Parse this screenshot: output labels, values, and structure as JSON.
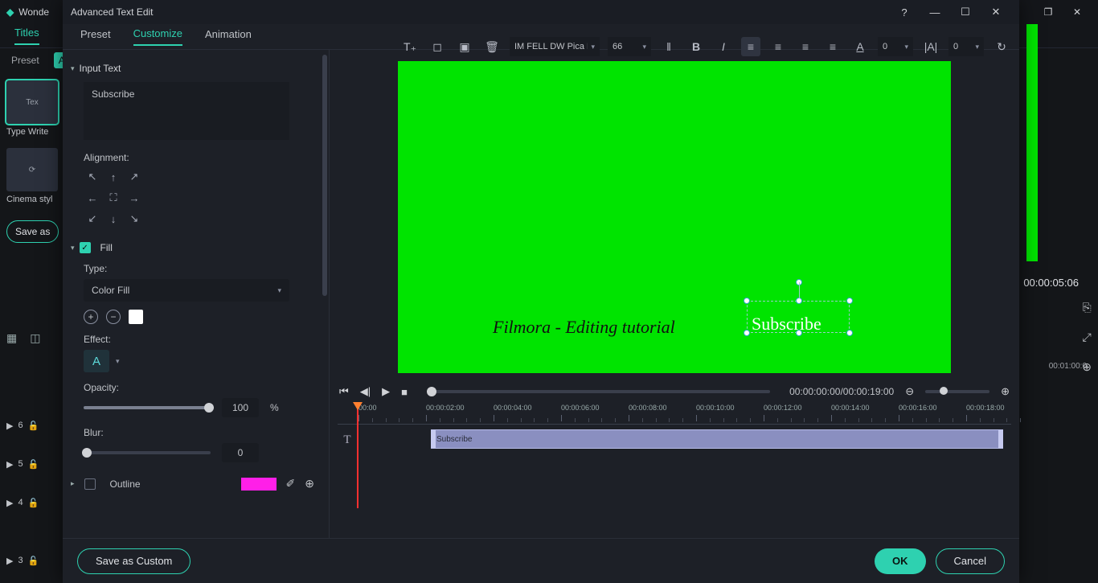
{
  "under": {
    "app_name": "Wonde",
    "tabs": [
      "Titles"
    ],
    "sub": {
      "preset": "Preset",
      "active": "A"
    },
    "thumb1_inner": "Tex",
    "thumb1_label": "Type Write",
    "thumb2_label": "Cinema styl",
    "save_btn": "Save as",
    "tracks": {
      "t6": "6",
      "t5": "5",
      "t4": "4",
      "t3": "3"
    },
    "time": "00:00:05:06",
    "rtime2": "00:01:00:0"
  },
  "modal": {
    "title": "Advanced Text Edit",
    "tabs": {
      "preset": "Preset",
      "customize": "Customize",
      "animation": "Animation"
    },
    "input_section": "Input Text",
    "input_value": "Subscribe",
    "alignment_label": "Alignment:",
    "fill_label": "Fill",
    "type_label": "Type:",
    "type_value": "Color Fill",
    "effect_label": "Effect:",
    "effect_value": "A",
    "opacity_label": "Opacity:",
    "opacity_value": "100",
    "opacity_unit": "%",
    "blur_label": "Blur:",
    "blur_value": "0",
    "outline_label": "Outline",
    "toolbar": {
      "font": "IM FELL DW Pica F",
      "size": "66",
      "spacing": "0",
      "spacing2": "0"
    },
    "canvas": {
      "text1": "Filmora - Editing tutorial",
      "text2": "Subscribe"
    },
    "transport": {
      "time": "00:00:00:00/00:00:19:00"
    },
    "ruler": [
      "00:00",
      "00:00:02:00",
      "00:00:04:00",
      "00:00:06:00",
      "00:00:08:00",
      "00:00:10:00",
      "00:00:12:00",
      "00:00:14:00",
      "00:00:16:00",
      "00:00:18:00"
    ],
    "tclip": "Subscribe",
    "footer": {
      "save": "Save as Custom",
      "ok": "OK",
      "cancel": "Cancel"
    }
  }
}
